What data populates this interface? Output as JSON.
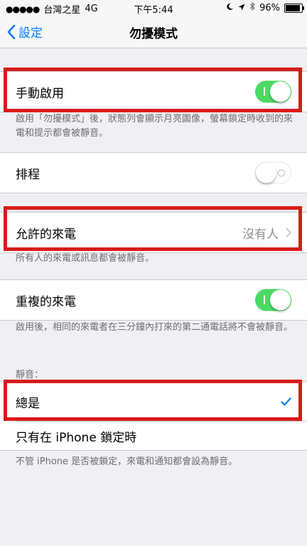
{
  "status_bar": {
    "signal": "●●●●●",
    "carrier": "台灣之星",
    "network": "4G",
    "time": "下午5:44",
    "battery": "96%"
  },
  "nav": {
    "back_label": "設定",
    "title": "勿擾模式"
  },
  "manual": {
    "label": "手動啟用",
    "enabled": true,
    "footer": "啟用「勿擾模式」後，狀態列會顯示月亮圖像，螢幕鎖定時收到的來電和提示都會被靜音。"
  },
  "scheduled": {
    "label": "排程",
    "enabled": false
  },
  "allow_calls": {
    "label": "允許的來電",
    "value": "沒有人",
    "footer": "所有人的來電或訊息都會被靜音。"
  },
  "repeated_calls": {
    "label": "重複的來電",
    "enabled": true,
    "footer": "啟用後，相同的來電者在三分鐘內打來的第二通電話將不會被靜音。"
  },
  "silence": {
    "header": "靜音：",
    "options": [
      {
        "label": "總是",
        "selected": true
      },
      {
        "label": "只有在 iPhone 鎖定時",
        "selected": false
      }
    ],
    "footer": "不管 iPhone 是否被鎖定，來電和通知都會設為靜音。"
  },
  "colors": {
    "accent": "#007aff",
    "toggle_on": "#4cd964",
    "highlight": "#d91a1a",
    "background": "#efeff4"
  },
  "icons": [
    "back-chevron-icon",
    "moon-icon",
    "location-arrow-icon",
    "bluetooth-icon",
    "battery-icon",
    "disclosure-chevron-icon",
    "checkmark-icon"
  ]
}
